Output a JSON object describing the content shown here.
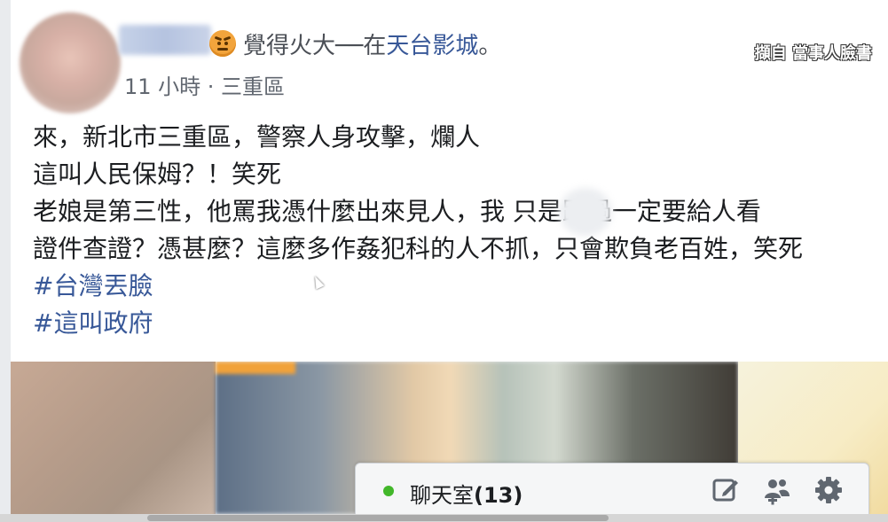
{
  "post": {
    "feeling_text": "覺得火大──在",
    "place_text": "天台影城",
    "period": "。",
    "emoji_icon": "angry-face-icon",
    "meta_text": "11 小時 · 三重區",
    "watermark": "擷自 當事人臉書",
    "body_lines": [
      "來，新北市三重區，警察人身攻擊，爛人",
      "這叫人民保姆？！笑死",
      "老娘是第三性，他罵我憑什麼出來見人，我      只是路過一定要給人看",
      "證件查證？憑甚麼？這麼多作姦犯科的人不抓，只會欺負老百姓，笑死"
    ],
    "hashtags": [
      "#台灣丟臉",
      "#這叫政府"
    ]
  },
  "chat": {
    "label": "聊天室",
    "count": "(13)",
    "status_color": "#42b72a",
    "icons": [
      "edit-icon",
      "add-people-icon",
      "gear-icon"
    ]
  },
  "colors": {
    "link": "#385898",
    "text": "#1c1e21",
    "meta": "#616770"
  }
}
